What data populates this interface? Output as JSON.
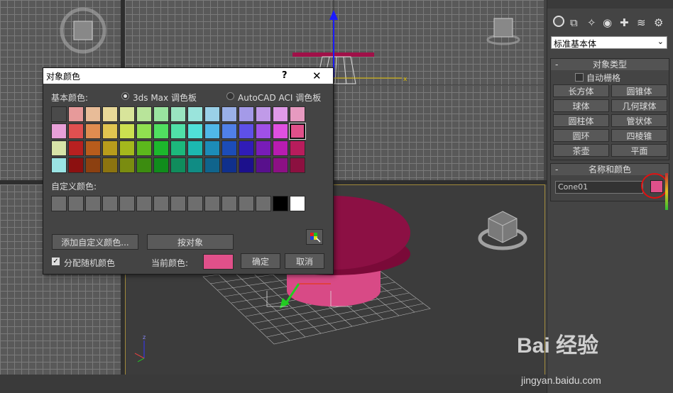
{
  "dialog": {
    "title": "对象颜色",
    "help_label": "?",
    "close_label": "✕",
    "basic_colors_label": "基本颜色:",
    "palette_3dsmax_label": "3ds Max 调色板",
    "palette_autocad_label": "AutoCAD ACI 调色板",
    "custom_colors_label": "自定义颜色:",
    "add_custom_label": "添加自定义颜色...",
    "by_object_label": "按对象",
    "assign_random_label": "分配随机颜色",
    "current_color_label": "当前颜色:",
    "ok_label": "确定",
    "cancel_label": "取消",
    "current_color": "#e0508a",
    "basic_colors": [
      [
        "#4a4a4a",
        "#e79a9a",
        "#e8bc98",
        "#e8d898",
        "#d8e49a",
        "#b8e49a",
        "#9ae4a0",
        "#9ae4c0",
        "#9ae4dc",
        "#9ad0e8",
        "#9ab0e8",
        "#a49ae8",
        "#c09ae8",
        "#e09ae8",
        "#e79ac0"
      ],
      [
        "#e8a0d8",
        "#e05050",
        "#e08c50",
        "#e0c450",
        "#cce050",
        "#90e050",
        "#50e060",
        "#50e0a8",
        "#50e0d8",
        "#50b8e8",
        "#5080e8",
        "#5e50e8",
        "#a050e8",
        "#e050e0",
        "#e0508a"
      ],
      [
        "#d8e4a8",
        "#b82020",
        "#b85c1c",
        "#b89c1c",
        "#a4b81c",
        "#5cb81c",
        "#1cb82c",
        "#1cb87c",
        "#1cb8b0",
        "#1c8cb8",
        "#1c4cb8",
        "#301cb8",
        "#781cb8",
        "#b81cb0",
        "#b81c5c"
      ],
      [
        "#9ae4e4",
        "#8c1010",
        "#8c4010",
        "#8c7410",
        "#7a8c10",
        "#3c8c10",
        "#108c1c",
        "#108c5c",
        "#108c84",
        "#10648c",
        "#10308c",
        "#1c108c",
        "#58108c",
        "#8c1084",
        "#8c1040"
      ]
    ],
    "custom_colors": [
      "#6e6e6e",
      "#6e6e6e",
      "#6e6e6e",
      "#6e6e6e",
      "#6e6e6e",
      "#6e6e6e",
      "#6e6e6e",
      "#6e6e6e",
      "#6e6e6e",
      "#6e6e6e",
      "#6e6e6e",
      "#6e6e6e",
      "#6e6e6e",
      "#000000",
      "#ffffff"
    ]
  },
  "command_panel": {
    "category_dropdown": "标准基本体",
    "object_type_title": "对象类型",
    "autogrid_label": "自动栅格",
    "object_buttons": [
      "长方体",
      "圆锥体",
      "球体",
      "几何球体",
      "圆柱体",
      "管状体",
      "圆环",
      "四棱锥",
      "茶壶",
      "平面"
    ],
    "name_color_title": "名称和颜色",
    "object_name": "Cone01",
    "object_color": "#e0508a"
  },
  "viewport": {
    "axis_x": "x",
    "axis_z": "z"
  },
  "watermark": {
    "brand": "Bai 经验",
    "url": "jingyan.baidu.com"
  }
}
